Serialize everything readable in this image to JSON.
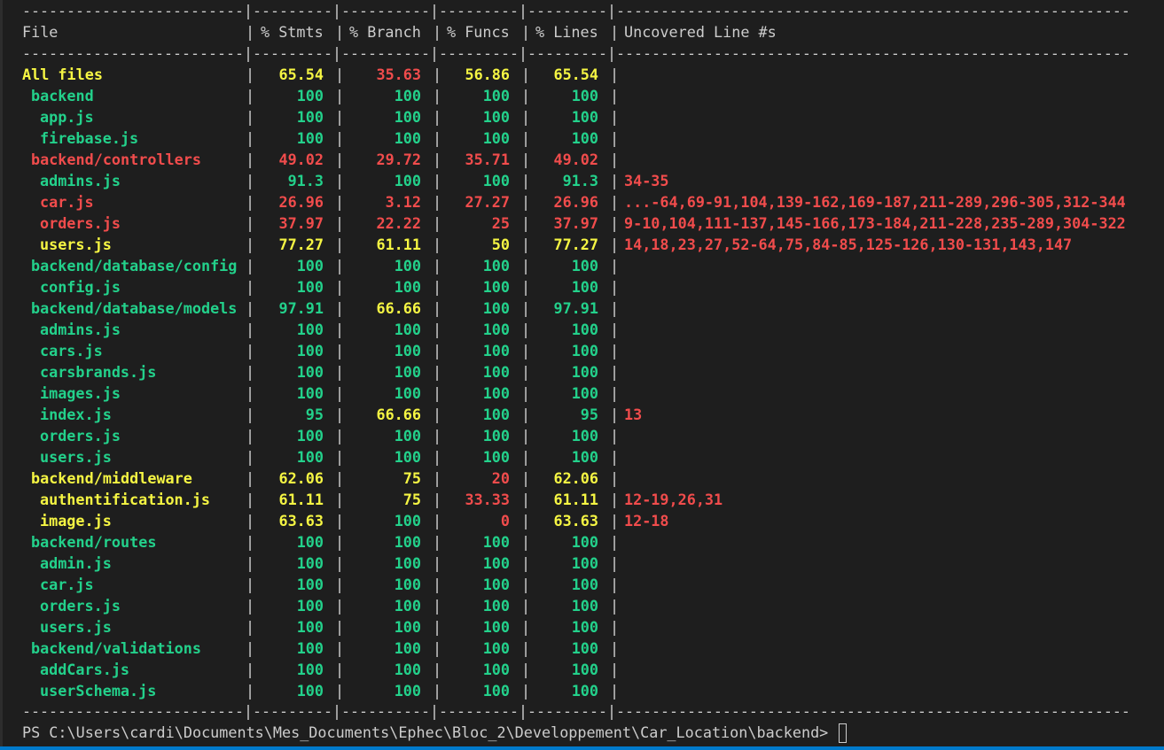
{
  "header": {
    "file": "File",
    "stmts": "% Stmts",
    "branch": "% Branch",
    "funcs": "% Funcs",
    "lines": "% Lines",
    "uncovered": "Uncovered Line #s"
  },
  "colors": {
    "background": "#1e1e1e",
    "green": "#23d18b",
    "yellow": "#f5f543",
    "red": "#f14c4c",
    "default": "#cccccc"
  },
  "rows": [
    {
      "file": "All files",
      "indent": 0,
      "fileColor": "yellow",
      "stmts": "65.54",
      "stmtsColor": "yellow",
      "branch": "35.63",
      "branchColor": "red",
      "funcs": "56.86",
      "funcsColor": "yellow",
      "lines": "65.54",
      "linesColor": "yellow",
      "uncovered": "",
      "uncoveredColor": "red"
    },
    {
      "file": "backend",
      "indent": 1,
      "fileColor": "green",
      "stmts": "100",
      "stmtsColor": "green",
      "branch": "100",
      "branchColor": "green",
      "funcs": "100",
      "funcsColor": "green",
      "lines": "100",
      "linesColor": "green",
      "uncovered": "",
      "uncoveredColor": "red"
    },
    {
      "file": "app.js",
      "indent": 2,
      "fileColor": "green",
      "stmts": "100",
      "stmtsColor": "green",
      "branch": "100",
      "branchColor": "green",
      "funcs": "100",
      "funcsColor": "green",
      "lines": "100",
      "linesColor": "green",
      "uncovered": "",
      "uncoveredColor": "red"
    },
    {
      "file": "firebase.js",
      "indent": 2,
      "fileColor": "green",
      "stmts": "100",
      "stmtsColor": "green",
      "branch": "100",
      "branchColor": "green",
      "funcs": "100",
      "funcsColor": "green",
      "lines": "100",
      "linesColor": "green",
      "uncovered": "",
      "uncoveredColor": "red"
    },
    {
      "file": "backend/controllers",
      "indent": 1,
      "fileColor": "red",
      "stmts": "49.02",
      "stmtsColor": "red",
      "branch": "29.72",
      "branchColor": "red",
      "funcs": "35.71",
      "funcsColor": "red",
      "lines": "49.02",
      "linesColor": "red",
      "uncovered": "",
      "uncoveredColor": "red"
    },
    {
      "file": "admins.js",
      "indent": 2,
      "fileColor": "green",
      "stmts": "91.3",
      "stmtsColor": "green",
      "branch": "100",
      "branchColor": "green",
      "funcs": "100",
      "funcsColor": "green",
      "lines": "91.3",
      "linesColor": "green",
      "uncovered": "34-35",
      "uncoveredColor": "red"
    },
    {
      "file": "car.js",
      "indent": 2,
      "fileColor": "red",
      "stmts": "26.96",
      "stmtsColor": "red",
      "branch": "3.12",
      "branchColor": "red",
      "funcs": "27.27",
      "funcsColor": "red",
      "lines": "26.96",
      "linesColor": "red",
      "uncovered": "...-64,69-91,104,139-162,169-187,211-289,296-305,312-344",
      "uncoveredColor": "red"
    },
    {
      "file": "orders.js",
      "indent": 2,
      "fileColor": "red",
      "stmts": "37.97",
      "stmtsColor": "red",
      "branch": "22.22",
      "branchColor": "red",
      "funcs": "25",
      "funcsColor": "red",
      "lines": "37.97",
      "linesColor": "red",
      "uncovered": "9-10,104,111-137,145-166,173-184,211-228,235-289,304-322",
      "uncoveredColor": "red"
    },
    {
      "file": "users.js",
      "indent": 2,
      "fileColor": "yellow",
      "stmts": "77.27",
      "stmtsColor": "yellow",
      "branch": "61.11",
      "branchColor": "yellow",
      "funcs": "50",
      "funcsColor": "yellow",
      "lines": "77.27",
      "linesColor": "yellow",
      "uncovered": "14,18,23,27,52-64,75,84-85,125-126,130-131,143,147",
      "uncoveredColor": "red"
    },
    {
      "file": "backend/database/config",
      "indent": 1,
      "fileColor": "green",
      "stmts": "100",
      "stmtsColor": "green",
      "branch": "100",
      "branchColor": "green",
      "funcs": "100",
      "funcsColor": "green",
      "lines": "100",
      "linesColor": "green",
      "uncovered": "",
      "uncoveredColor": "red"
    },
    {
      "file": "config.js",
      "indent": 2,
      "fileColor": "green",
      "stmts": "100",
      "stmtsColor": "green",
      "branch": "100",
      "branchColor": "green",
      "funcs": "100",
      "funcsColor": "green",
      "lines": "100",
      "linesColor": "green",
      "uncovered": "",
      "uncoveredColor": "red"
    },
    {
      "file": "backend/database/models",
      "indent": 1,
      "fileColor": "green",
      "stmts": "97.91",
      "stmtsColor": "green",
      "branch": "66.66",
      "branchColor": "yellow",
      "funcs": "100",
      "funcsColor": "green",
      "lines": "97.91",
      "linesColor": "green",
      "uncovered": "",
      "uncoveredColor": "red"
    },
    {
      "file": "admins.js",
      "indent": 2,
      "fileColor": "green",
      "stmts": "100",
      "stmtsColor": "green",
      "branch": "100",
      "branchColor": "green",
      "funcs": "100",
      "funcsColor": "green",
      "lines": "100",
      "linesColor": "green",
      "uncovered": "",
      "uncoveredColor": "red"
    },
    {
      "file": "cars.js",
      "indent": 2,
      "fileColor": "green",
      "stmts": "100",
      "stmtsColor": "green",
      "branch": "100",
      "branchColor": "green",
      "funcs": "100",
      "funcsColor": "green",
      "lines": "100",
      "linesColor": "green",
      "uncovered": "",
      "uncoveredColor": "red"
    },
    {
      "file": "carsbrands.js",
      "indent": 2,
      "fileColor": "green",
      "stmts": "100",
      "stmtsColor": "green",
      "branch": "100",
      "branchColor": "green",
      "funcs": "100",
      "funcsColor": "green",
      "lines": "100",
      "linesColor": "green",
      "uncovered": "",
      "uncoveredColor": "red"
    },
    {
      "file": "images.js",
      "indent": 2,
      "fileColor": "green",
      "stmts": "100",
      "stmtsColor": "green",
      "branch": "100",
      "branchColor": "green",
      "funcs": "100",
      "funcsColor": "green",
      "lines": "100",
      "linesColor": "green",
      "uncovered": "",
      "uncoveredColor": "red"
    },
    {
      "file": "index.js",
      "indent": 2,
      "fileColor": "green",
      "stmts": "95",
      "stmtsColor": "green",
      "branch": "66.66",
      "branchColor": "yellow",
      "funcs": "100",
      "funcsColor": "green",
      "lines": "95",
      "linesColor": "green",
      "uncovered": "13",
      "uncoveredColor": "red"
    },
    {
      "file": "orders.js",
      "indent": 2,
      "fileColor": "green",
      "stmts": "100",
      "stmtsColor": "green",
      "branch": "100",
      "branchColor": "green",
      "funcs": "100",
      "funcsColor": "green",
      "lines": "100",
      "linesColor": "green",
      "uncovered": "",
      "uncoveredColor": "red"
    },
    {
      "file": "users.js",
      "indent": 2,
      "fileColor": "green",
      "stmts": "100",
      "stmtsColor": "green",
      "branch": "100",
      "branchColor": "green",
      "funcs": "100",
      "funcsColor": "green",
      "lines": "100",
      "linesColor": "green",
      "uncovered": "",
      "uncoveredColor": "red"
    },
    {
      "file": "backend/middleware",
      "indent": 1,
      "fileColor": "yellow",
      "stmts": "62.06",
      "stmtsColor": "yellow",
      "branch": "75",
      "branchColor": "yellow",
      "funcs": "20",
      "funcsColor": "red",
      "lines": "62.06",
      "linesColor": "yellow",
      "uncovered": "",
      "uncoveredColor": "red"
    },
    {
      "file": "authentification.js",
      "indent": 2,
      "fileColor": "yellow",
      "stmts": "61.11",
      "stmtsColor": "yellow",
      "branch": "75",
      "branchColor": "yellow",
      "funcs": "33.33",
      "funcsColor": "red",
      "lines": "61.11",
      "linesColor": "yellow",
      "uncovered": "12-19,26,31",
      "uncoveredColor": "red"
    },
    {
      "file": "image.js",
      "indent": 2,
      "fileColor": "yellow",
      "stmts": "63.63",
      "stmtsColor": "yellow",
      "branch": "100",
      "branchColor": "green",
      "funcs": "0",
      "funcsColor": "red",
      "lines": "63.63",
      "linesColor": "yellow",
      "uncovered": "12-18",
      "uncoveredColor": "red"
    },
    {
      "file": "backend/routes",
      "indent": 1,
      "fileColor": "green",
      "stmts": "100",
      "stmtsColor": "green",
      "branch": "100",
      "branchColor": "green",
      "funcs": "100",
      "funcsColor": "green",
      "lines": "100",
      "linesColor": "green",
      "uncovered": "",
      "uncoveredColor": "red"
    },
    {
      "file": "admin.js",
      "indent": 2,
      "fileColor": "green",
      "stmts": "100",
      "stmtsColor": "green",
      "branch": "100",
      "branchColor": "green",
      "funcs": "100",
      "funcsColor": "green",
      "lines": "100",
      "linesColor": "green",
      "uncovered": "",
      "uncoveredColor": "red"
    },
    {
      "file": "car.js",
      "indent": 2,
      "fileColor": "green",
      "stmts": "100",
      "stmtsColor": "green",
      "branch": "100",
      "branchColor": "green",
      "funcs": "100",
      "funcsColor": "green",
      "lines": "100",
      "linesColor": "green",
      "uncovered": "",
      "uncoveredColor": "red"
    },
    {
      "file": "orders.js",
      "indent": 2,
      "fileColor": "green",
      "stmts": "100",
      "stmtsColor": "green",
      "branch": "100",
      "branchColor": "green",
      "funcs": "100",
      "funcsColor": "green",
      "lines": "100",
      "linesColor": "green",
      "uncovered": "",
      "uncoveredColor": "red"
    },
    {
      "file": "users.js",
      "indent": 2,
      "fileColor": "green",
      "stmts": "100",
      "stmtsColor": "green",
      "branch": "100",
      "branchColor": "green",
      "funcs": "100",
      "funcsColor": "green",
      "lines": "100",
      "linesColor": "green",
      "uncovered": "",
      "uncoveredColor": "red"
    },
    {
      "file": "backend/validations",
      "indent": 1,
      "fileColor": "green",
      "stmts": "100",
      "stmtsColor": "green",
      "branch": "100",
      "branchColor": "green",
      "funcs": "100",
      "funcsColor": "green",
      "lines": "100",
      "linesColor": "green",
      "uncovered": "",
      "uncoveredColor": "red"
    },
    {
      "file": "addCars.js",
      "indent": 2,
      "fileColor": "green",
      "stmts": "100",
      "stmtsColor": "green",
      "branch": "100",
      "branchColor": "green",
      "funcs": "100",
      "funcsColor": "green",
      "lines": "100",
      "linesColor": "green",
      "uncovered": "",
      "uncoveredColor": "red"
    },
    {
      "file": "userSchema.js",
      "indent": 2,
      "fileColor": "green",
      "stmts": "100",
      "stmtsColor": "green",
      "branch": "100",
      "branchColor": "green",
      "funcs": "100",
      "funcsColor": "green",
      "lines": "100",
      "linesColor": "green",
      "uncovered": "",
      "uncoveredColor": "red"
    }
  ],
  "prompt": {
    "text": "PS C:\\Users\\cardi\\Documents\\Mes_Documents\\Ephec\\Bloc_2\\Developpement\\Car_Location\\backend> "
  }
}
